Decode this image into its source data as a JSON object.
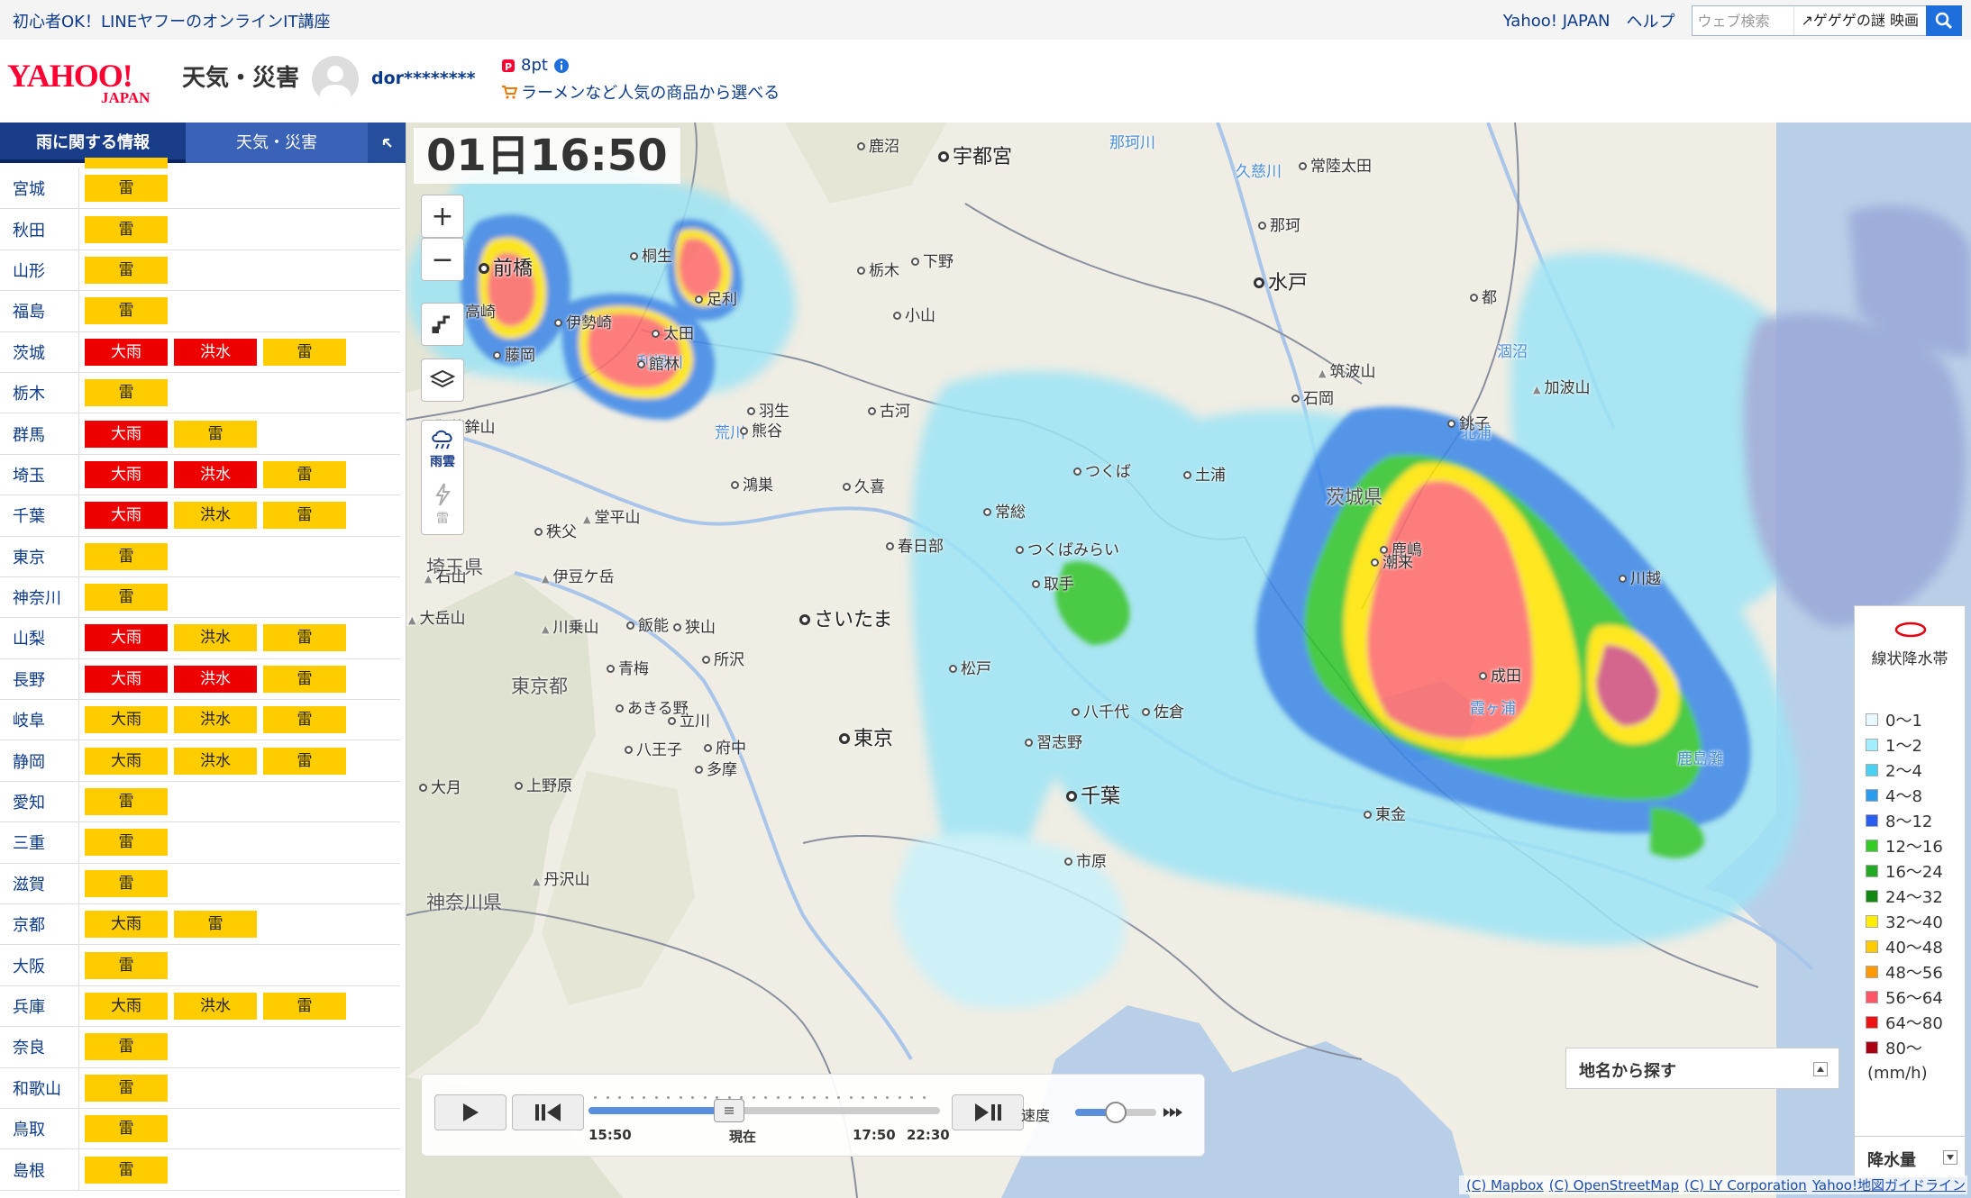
{
  "topbar": {
    "promo": "初心者OK！LINEヤフーのオンラインIT講座",
    "links": [
      "Yahoo! JAPAN",
      "ヘルプ"
    ],
    "search_placeholder": "ウェブ検索",
    "search_suggest": "ゲゲゲの謎 映画"
  },
  "header": {
    "logo_text": "YAHOO! JAPAN",
    "service_name": "天気・災害",
    "username": "dor********",
    "points": "8pt",
    "promo": "ラーメンなど人気の商品から選べる"
  },
  "sidebar": {
    "tabs": [
      "雨に関する情報",
      "天気・災害"
    ],
    "rows": [
      {
        "pref": "宮城",
        "alerts": [
          {
            "label": "雷",
            "level": "yellow"
          }
        ]
      },
      {
        "pref": "秋田",
        "alerts": [
          {
            "label": "雷",
            "level": "yellow"
          }
        ]
      },
      {
        "pref": "山形",
        "alerts": [
          {
            "label": "雷",
            "level": "yellow"
          }
        ]
      },
      {
        "pref": "福島",
        "alerts": [
          {
            "label": "雷",
            "level": "yellow"
          }
        ]
      },
      {
        "pref": "茨城",
        "alerts": [
          {
            "label": "大雨",
            "level": "red"
          },
          {
            "label": "洪水",
            "level": "red"
          },
          {
            "label": "雷",
            "level": "yellow"
          }
        ]
      },
      {
        "pref": "栃木",
        "alerts": [
          {
            "label": "雷",
            "level": "yellow"
          }
        ]
      },
      {
        "pref": "群馬",
        "alerts": [
          {
            "label": "大雨",
            "level": "red"
          },
          {
            "label": "雷",
            "level": "yellow"
          }
        ]
      },
      {
        "pref": "埼玉",
        "alerts": [
          {
            "label": "大雨",
            "level": "red"
          },
          {
            "label": "洪水",
            "level": "red"
          },
          {
            "label": "雷",
            "level": "yellow"
          }
        ]
      },
      {
        "pref": "千葉",
        "alerts": [
          {
            "label": "大雨",
            "level": "red"
          },
          {
            "label": "洪水",
            "level": "yellow"
          },
          {
            "label": "雷",
            "level": "yellow"
          }
        ]
      },
      {
        "pref": "東京",
        "alerts": [
          {
            "label": "雷",
            "level": "yellow"
          }
        ]
      },
      {
        "pref": "神奈川",
        "alerts": [
          {
            "label": "雷",
            "level": "yellow"
          }
        ]
      },
      {
        "pref": "山梨",
        "alerts": [
          {
            "label": "大雨",
            "level": "red"
          },
          {
            "label": "洪水",
            "level": "yellow"
          },
          {
            "label": "雷",
            "level": "yellow"
          }
        ]
      },
      {
        "pref": "長野",
        "alerts": [
          {
            "label": "大雨",
            "level": "red"
          },
          {
            "label": "洪水",
            "level": "red"
          },
          {
            "label": "雷",
            "level": "yellow"
          }
        ]
      },
      {
        "pref": "岐阜",
        "alerts": [
          {
            "label": "大雨",
            "level": "yellow"
          },
          {
            "label": "洪水",
            "level": "yellow"
          },
          {
            "label": "雷",
            "level": "yellow"
          }
        ]
      },
      {
        "pref": "静岡",
        "alerts": [
          {
            "label": "大雨",
            "level": "yellow"
          },
          {
            "label": "洪水",
            "level": "yellow"
          },
          {
            "label": "雷",
            "level": "yellow"
          }
        ]
      },
      {
        "pref": "愛知",
        "alerts": [
          {
            "label": "雷",
            "level": "yellow"
          }
        ]
      },
      {
        "pref": "三重",
        "alerts": [
          {
            "label": "雷",
            "level": "yellow"
          }
        ]
      },
      {
        "pref": "滋賀",
        "alerts": [
          {
            "label": "雷",
            "level": "yellow"
          }
        ]
      },
      {
        "pref": "京都",
        "alerts": [
          {
            "label": "大雨",
            "level": "yellow"
          },
          {
            "label": "雷",
            "level": "yellow"
          }
        ]
      },
      {
        "pref": "大阪",
        "alerts": [
          {
            "label": "雷",
            "level": "yellow"
          }
        ]
      },
      {
        "pref": "兵庫",
        "alerts": [
          {
            "label": "大雨",
            "level": "yellow"
          },
          {
            "label": "洪水",
            "level": "yellow"
          },
          {
            "label": "雷",
            "level": "yellow"
          }
        ]
      },
      {
        "pref": "奈良",
        "alerts": [
          {
            "label": "雷",
            "level": "yellow"
          }
        ]
      },
      {
        "pref": "和歌山",
        "alerts": [
          {
            "label": "雷",
            "level": "yellow"
          }
        ]
      },
      {
        "pref": "鳥取",
        "alerts": [
          {
            "label": "雷",
            "level": "yellow"
          }
        ]
      },
      {
        "pref": "島根",
        "alerts": [
          {
            "label": "雷",
            "level": "yellow"
          }
        ]
      }
    ]
  },
  "map": {
    "time": "01日16:50",
    "layers": [
      "雨雲",
      "雷"
    ],
    "places": [
      {
        "name": "鹿沼",
        "kind": "city"
      },
      {
        "name": "宇都宮",
        "kind": "big"
      },
      {
        "name": "那珂川",
        "kind": "river"
      },
      {
        "name": "常陸太田",
        "kind": "city"
      },
      {
        "name": "久慈川",
        "kind": "river"
      },
      {
        "name": "前橋",
        "kind": "big"
      },
      {
        "name": "桐生",
        "kind": "city"
      },
      {
        "name": "栃木",
        "kind": "city"
      },
      {
        "name": "下野",
        "kind": "city"
      },
      {
        "name": "那珂",
        "kind": "city"
      },
      {
        "name": "水戸",
        "kind": "big"
      },
      {
        "name": "高崎",
        "kind": "city"
      },
      {
        "name": "伊勢崎",
        "kind": "city"
      },
      {
        "name": "足利",
        "kind": "city"
      },
      {
        "name": "太田",
        "kind": "city"
      },
      {
        "name": "小山",
        "kind": "city"
      },
      {
        "name": "藤岡",
        "kind": "city"
      },
      {
        "name": "利根川",
        "kind": "river"
      },
      {
        "name": "館林",
        "kind": "city"
      },
      {
        "name": "筑波山",
        "kind": "peak"
      },
      {
        "name": "石岡",
        "kind": "city"
      },
      {
        "name": "古河",
        "kind": "city"
      },
      {
        "name": "羽生",
        "kind": "city"
      },
      {
        "name": "御荷鉾山",
        "kind": "peak"
      },
      {
        "name": "荒川",
        "kind": "river"
      },
      {
        "name": "熊谷",
        "kind": "city"
      },
      {
        "name": "つくば",
        "kind": "city"
      },
      {
        "name": "土浦",
        "kind": "city"
      },
      {
        "name": "茨城県",
        "kind": "region"
      },
      {
        "name": "鴻巣",
        "kind": "city"
      },
      {
        "name": "久喜",
        "kind": "city"
      },
      {
        "name": "常総",
        "kind": "city"
      },
      {
        "name": "鹿嶋",
        "kind": "city"
      },
      {
        "name": "秩父",
        "kind": "city"
      },
      {
        "name": "堂平山",
        "kind": "peak"
      },
      {
        "name": "春日部",
        "kind": "city"
      },
      {
        "name": "つくばみらい",
        "kind": "city"
      },
      {
        "name": "潮来",
        "kind": "city"
      },
      {
        "name": "埼玉県",
        "kind": "region"
      },
      {
        "name": "伊豆ケ岳",
        "kind": "peak"
      },
      {
        "name": "川越",
        "kind": "city"
      },
      {
        "name": "取手",
        "kind": "city"
      },
      {
        "name": "さいたま",
        "kind": "big"
      },
      {
        "name": "飯能",
        "kind": "city"
      },
      {
        "name": "狭山",
        "kind": "city"
      },
      {
        "name": "川乗山",
        "kind": "peak"
      },
      {
        "name": "所沢",
        "kind": "city"
      },
      {
        "name": "青梅",
        "kind": "city"
      },
      {
        "name": "松戸",
        "kind": "city"
      },
      {
        "name": "成田",
        "kind": "city"
      },
      {
        "name": "東京都",
        "kind": "region"
      },
      {
        "name": "あきる野",
        "kind": "city"
      },
      {
        "name": "立川",
        "kind": "city"
      },
      {
        "name": "八千代",
        "kind": "city"
      },
      {
        "name": "佐倉",
        "kind": "city"
      },
      {
        "name": "東京",
        "kind": "big"
      },
      {
        "name": "習志野",
        "kind": "city"
      },
      {
        "name": "八王子",
        "kind": "city"
      },
      {
        "name": "府中",
        "kind": "city"
      },
      {
        "name": "多摩",
        "kind": "city"
      },
      {
        "name": "上野原",
        "kind": "city"
      },
      {
        "name": "大月",
        "kind": "city"
      },
      {
        "name": "千葉",
        "kind": "big"
      },
      {
        "name": "東金",
        "kind": "city"
      },
      {
        "name": "市原",
        "kind": "city"
      },
      {
        "name": "丹沢山",
        "kind": "peak"
      },
      {
        "name": "神奈川県",
        "kind": "region"
      },
      {
        "name": "大岳山",
        "kind": "peak"
      },
      {
        "name": "石山",
        "kind": "peak"
      },
      {
        "name": "霞ヶ浦",
        "kind": "river"
      },
      {
        "name": "北浦",
        "kind": "river"
      },
      {
        "name": "涸沼",
        "kind": "river"
      },
      {
        "name": "加波山",
        "kind": "peak"
      },
      {
        "name": "銚子",
        "kind": "city"
      },
      {
        "name": "鹿島灘",
        "kind": "river"
      },
      {
        "name": "都",
        "kind": "city"
      }
    ],
    "player": {
      "times": [
        "15:50",
        "現在",
        "17:50",
        "22:30"
      ],
      "speed_label": "速度",
      "progress": 0.4,
      "speed": 0.5
    },
    "place_search_label": "地名から探す",
    "legend": {
      "title": "線状降水帯",
      "items": [
        {
          "label": "0～1",
          "color": "#e8f8ff"
        },
        {
          "label": "1～2",
          "color": "#a0eeff"
        },
        {
          "label": "2～4",
          "color": "#4ad0f0"
        },
        {
          "label": "4～8",
          "color": "#2a9cf0"
        },
        {
          "label": "8～12",
          "color": "#2a5ef0"
        },
        {
          "label": "12～16",
          "color": "#33cc22"
        },
        {
          "label": "16～24",
          "color": "#22aa22"
        },
        {
          "label": "24～32",
          "color": "#118811"
        },
        {
          "label": "32～40",
          "color": "#ffee00"
        },
        {
          "label": "40～48",
          "color": "#ffcc00"
        },
        {
          "label": "48～56",
          "color": "#ff9900"
        },
        {
          "label": "56～64",
          "color": "#ff5566"
        },
        {
          "label": "64～80",
          "color": "#ee1111"
        },
        {
          "label": "80～",
          "color": "#aa0011"
        }
      ],
      "unit": "(mm/h)",
      "footer_label": "降水量"
    },
    "attribution": [
      "(C) Mapbox",
      "(C) OpenStreetMap",
      "(C) LY Corporation",
      "Yahoo!地図ガイドライン"
    ]
  }
}
